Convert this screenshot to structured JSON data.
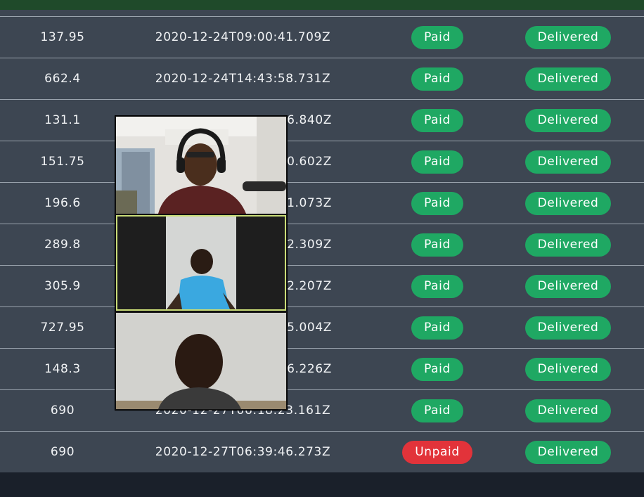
{
  "orders": [
    {
      "amount": "137.95",
      "date": "2020-12-24T09:00:41.709Z",
      "payment": "Paid",
      "delivery": "Delivered"
    },
    {
      "amount": "662.4",
      "date": "2020-12-24T14:43:58.731Z",
      "payment": "Paid",
      "delivery": "Delivered"
    },
    {
      "amount": "131.1",
      "date": "6.840Z",
      "payment": "Paid",
      "delivery": "Delivered"
    },
    {
      "amount": "151.75",
      "date": "0.602Z",
      "payment": "Paid",
      "delivery": "Delivered"
    },
    {
      "amount": "196.6",
      "date": "1.073Z",
      "payment": "Paid",
      "delivery": "Delivered"
    },
    {
      "amount": "289.8",
      "date": "2.309Z",
      "payment": "Paid",
      "delivery": "Delivered"
    },
    {
      "amount": "305.9",
      "date": "2.207Z",
      "payment": "Paid",
      "delivery": "Delivered"
    },
    {
      "amount": "727.95",
      "date": "5.004Z",
      "payment": "Paid",
      "delivery": "Delivered"
    },
    {
      "amount": "148.3",
      "date": "6.226Z",
      "payment": "Paid",
      "delivery": "Delivered"
    },
    {
      "amount": "690",
      "date": "2020-12-27T06:18:23.161Z",
      "payment": "Paid",
      "delivery": "Delivered"
    },
    {
      "amount": "690",
      "date": "2020-12-27T06:39:46.273Z",
      "payment": "Unpaid",
      "delivery": "Delivered"
    }
  ],
  "colors": {
    "row_bg": "#3d4652",
    "paid": "#1fa863",
    "unpaid": "#e2333a",
    "delivered": "#1fa863",
    "active_speaker_border": "#c9dc77"
  },
  "video_call": {
    "participants": [
      "participant-1-video",
      "participant-2-video",
      "participant-3-video"
    ]
  }
}
